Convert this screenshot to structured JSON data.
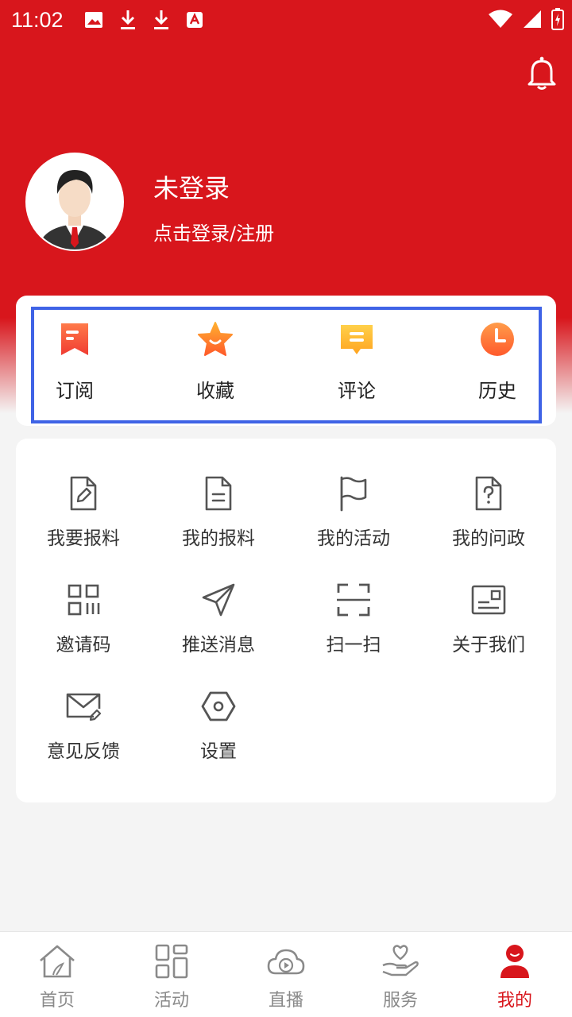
{
  "status_bar": {
    "time": "11:02"
  },
  "profile": {
    "name": "未登录",
    "subtitle": "点击登录/注册"
  },
  "quick_actions": [
    {
      "label": "订阅",
      "icon": "subscribe-icon"
    },
    {
      "label": "收藏",
      "icon": "star-icon"
    },
    {
      "label": "评论",
      "icon": "comment-icon"
    },
    {
      "label": "历史",
      "icon": "clock-icon"
    }
  ],
  "menu": [
    {
      "label": "我要报料",
      "icon": "edit-document-icon"
    },
    {
      "label": "我的报料",
      "icon": "document-icon"
    },
    {
      "label": "我的活动",
      "icon": "flag-icon"
    },
    {
      "label": "我的问政",
      "icon": "question-document-icon"
    },
    {
      "label": "邀请码",
      "icon": "qr-code-icon"
    },
    {
      "label": "推送消息",
      "icon": "send-icon"
    },
    {
      "label": "扫一扫",
      "icon": "scan-icon"
    },
    {
      "label": "关于我们",
      "icon": "about-card-icon"
    },
    {
      "label": "意见反馈",
      "icon": "feedback-mail-icon"
    },
    {
      "label": "设置",
      "icon": "settings-hexagon-icon"
    }
  ],
  "tabs": [
    {
      "label": "首页",
      "icon": "home-icon",
      "active": false
    },
    {
      "label": "活动",
      "icon": "activity-grid-icon",
      "active": false
    },
    {
      "label": "直播",
      "icon": "live-cloud-icon",
      "active": false
    },
    {
      "label": "服务",
      "icon": "service-hand-heart-icon",
      "active": false
    },
    {
      "label": "我的",
      "icon": "profile-icon",
      "active": true
    }
  ],
  "colors": {
    "brand_red": "#d8161c",
    "highlight_blue": "#3f63e6",
    "background": "#f4f4f4"
  }
}
